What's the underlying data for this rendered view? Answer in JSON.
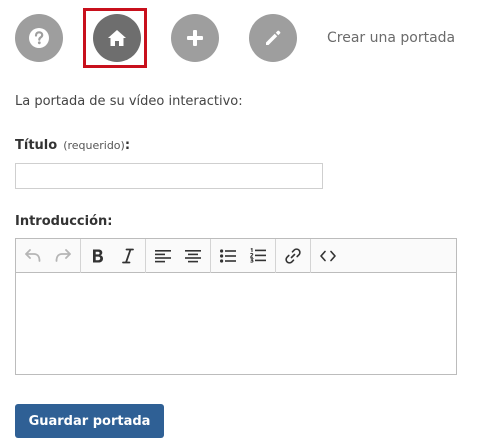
{
  "nav": {
    "step_title": "Crear una portada",
    "buttons": [
      {
        "icon": "help-icon",
        "active": false
      },
      {
        "icon": "home-icon",
        "active": true
      },
      {
        "icon": "plus-icon",
        "active": false
      },
      {
        "icon": "pencil-icon",
        "active": false
      }
    ],
    "highlight_color": "#c8101c"
  },
  "form": {
    "intro_text": "La portada de su vídeo interactivo:",
    "title_label": "Título",
    "title_required": "(requerido)",
    "title_colon": ":",
    "title_value": "",
    "intro_label": "Introducción:",
    "editor_content": "",
    "toolbar": [
      "undo-icon",
      "redo-icon",
      "bold-icon",
      "italic-icon",
      "align-left-icon",
      "align-center-icon",
      "bulleted-list-icon",
      "numbered-list-icon",
      "link-icon",
      "source-code-icon"
    ],
    "save_label": "Guardar portada"
  },
  "colors": {
    "button_grey": "#9e9e9e",
    "button_active": "#6e6e6e",
    "primary": "#2f6095"
  }
}
